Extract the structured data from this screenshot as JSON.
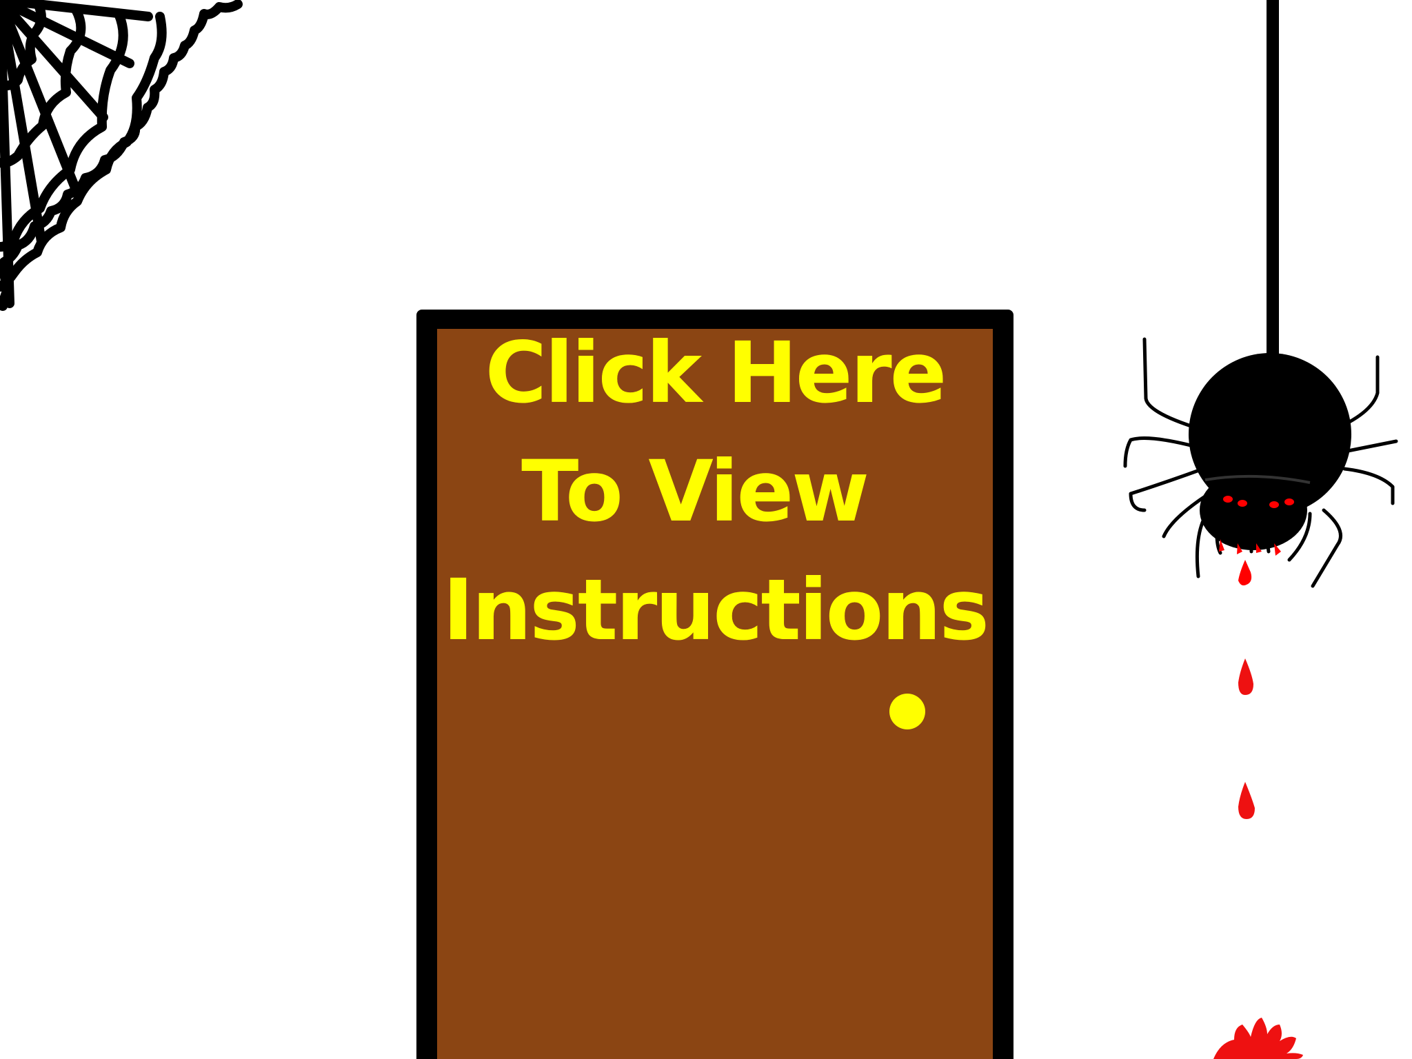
{
  "door": {
    "label_line1": "Click Here",
    "label_line2": "To View",
    "label_line3": "Instructions"
  },
  "colors": {
    "background": "#ffffff",
    "door_wood": "#8b4513",
    "door_frame": "#000000",
    "label_text": "#ffff00",
    "doorknob": "#ffff00",
    "blood": "#ee1111",
    "spider_body": "#000000",
    "spider_eyes": "#ff0000"
  },
  "icons": {
    "web": "cobweb-icon",
    "spider": "spider-icon",
    "drops": "blood-drop-icon",
    "splat": "blood-splat-icon",
    "knob": "doorknob-icon"
  }
}
